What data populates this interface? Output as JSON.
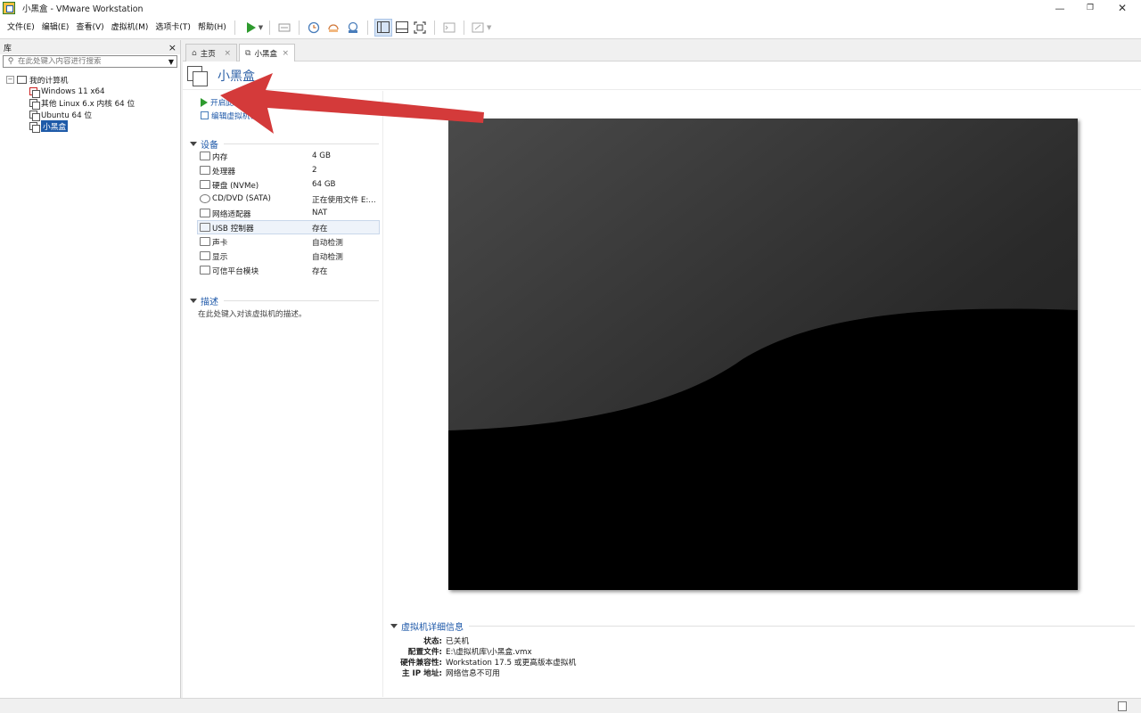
{
  "window": {
    "title": "小黑盒 - VMware Workstation",
    "minimize": "—",
    "maximize": "❐",
    "close": "✕"
  },
  "menu": {
    "items": [
      "文件(E)",
      "编辑(E)",
      "查看(V)",
      "虚拟机(M)",
      "选项卡(T)",
      "帮助(H)"
    ]
  },
  "library": {
    "title": "库",
    "close": "×",
    "search_placeholder": "在此处键入内容进行搜索",
    "root": "我的计算机",
    "vms": [
      {
        "name": "Windows 11 x64",
        "icon": "vm-icon-error"
      },
      {
        "name": "其他 Linux 6.x 内核 64 位",
        "icon": "vm-icon"
      },
      {
        "name": "Ubuntu 64 位",
        "icon": "vm-icon"
      },
      {
        "name": "小黑盒",
        "icon": "vm-icon",
        "selected": true
      }
    ]
  },
  "tabs": [
    {
      "label": "主页",
      "icon": "home-icon"
    },
    {
      "label": "小黑盒",
      "icon": "vm-icon",
      "active": true
    }
  ],
  "vm": {
    "name": "小黑盒",
    "actions": {
      "power_on": "开启此虚拟机",
      "edit": "编辑虚拟机设置"
    },
    "devices_title": "设备",
    "devices": [
      {
        "name": "内存",
        "value": "4 GB",
        "icon": "memory-icon"
      },
      {
        "name": "处理器",
        "value": "2",
        "icon": "cpu-icon"
      },
      {
        "name": "硬盘 (NVMe)",
        "value": "64 GB",
        "icon": "disk-icon"
      },
      {
        "name": "CD/DVD (SATA)",
        "value": "正在使用文件 E:...",
        "icon": "cd-icon"
      },
      {
        "name": "网络适配器",
        "value": "NAT",
        "icon": "network-icon"
      },
      {
        "name": "USB 控制器",
        "value": "存在",
        "icon": "usb-icon",
        "highlight": true
      },
      {
        "name": "声卡",
        "value": "自动检测",
        "icon": "sound-icon"
      },
      {
        "name": "显示",
        "value": "自动检测",
        "icon": "display-icon"
      },
      {
        "name": "可信平台模块",
        "value": "存在",
        "icon": "tpm-icon"
      }
    ],
    "description_title": "描述",
    "description_placeholder": "在此处键入对该虚拟机的描述。",
    "details_title": "虚拟机详细信息",
    "details": [
      {
        "key": "状态:",
        "value": "已关机"
      },
      {
        "key": "配置文件:",
        "value": "E:\\虚拟机库\\小黑盒.vmx"
      },
      {
        "key": "硬件兼容性:",
        "value": "Workstation 17.5 或更高版本虚拟机"
      },
      {
        "key": "主 IP 地址:",
        "value": "网络信息不可用"
      }
    ]
  },
  "colors": {
    "accent": "#1c57a8",
    "play": "#2e9a2e",
    "annotation_arrow": "#d43a3a"
  }
}
